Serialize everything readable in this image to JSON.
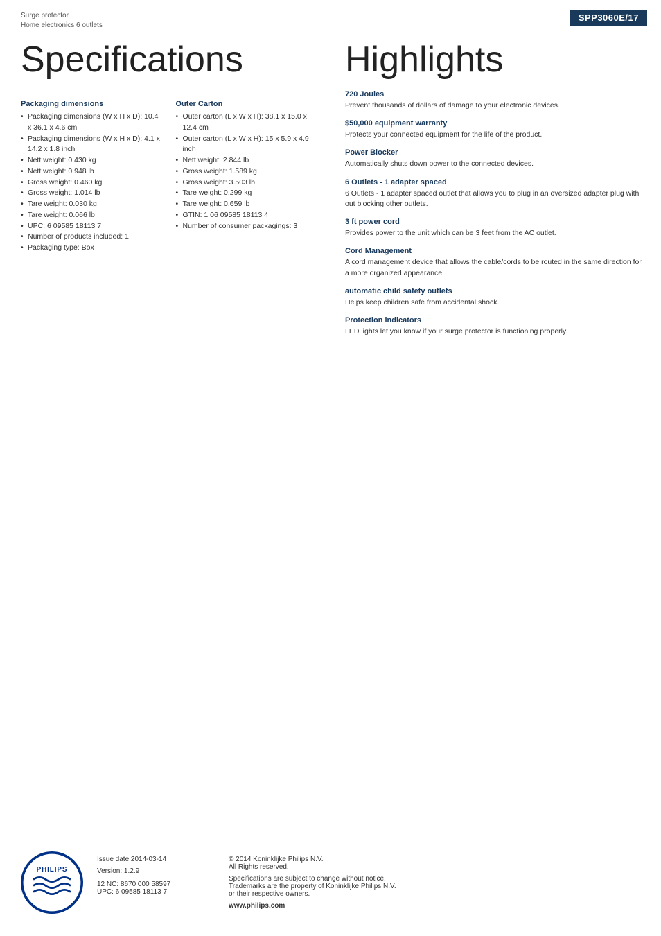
{
  "header": {
    "model": "SPP3060E/17",
    "product_type": "Surge protector",
    "product_name": "Home electronics 6 outlets"
  },
  "page_title": "Specifications",
  "highlights_title": "Highlights",
  "packaging": {
    "title": "Packaging dimensions",
    "items": [
      "Packaging dimensions (W x H x D): 10.4 x 36.1 x 4.6 cm",
      "Packaging dimensions (W x H x D): 4.1 x 14.2 x 1.8 inch",
      "Nett weight: 0.430 kg",
      "Nett weight: 0.948 lb",
      "Gross weight: 0.460 kg",
      "Gross weight: 1.014 lb",
      "Tare weight: 0.030 kg",
      "Tare weight: 0.066 lb",
      "UPC: 6 09585 18113 7",
      "Number of products included: 1",
      "Packaging type: Box"
    ]
  },
  "outer_carton": {
    "title": "Outer Carton",
    "items": [
      "Outer carton (L x W x H): 38.1 x 15.0 x 12.4 cm",
      "Outer carton (L x W x H): 15 x 5.9 x 4.9 inch",
      "Nett weight: 2.844 lb",
      "Gross weight: 1.589 kg",
      "Gross weight: 3.503 lb",
      "Tare weight: 0.299 kg",
      "Tare weight: 0.659 lb",
      "GTIN: 1 06 09585 18113 4",
      "Number of consumer packagings: 3"
    ]
  },
  "highlights": [
    {
      "title": "720 Joules",
      "desc": "Prevent thousands of dollars of damage to your electronic devices."
    },
    {
      "title": "$50,000 equipment warranty",
      "desc": "Protects your connected equipment for the life of the product."
    },
    {
      "title": "Power Blocker",
      "desc": "Automatically shuts down power to the connected devices."
    },
    {
      "title": "6 Outlets - 1 adapter spaced",
      "desc": "6 Outlets - 1 adapter spaced outlet that allows you to plug in an oversized adapter plug with out blocking other outlets."
    },
    {
      "title": "3 ft power cord",
      "desc": "Provides power to the unit which can be 3 feet from the AC outlet."
    },
    {
      "title": "Cord Management",
      "desc": "A cord management device that allows the cable/cords to be routed in the same direction for a more organized appearance"
    },
    {
      "title": "automatic child safety outlets",
      "desc": "Helps keep children safe from accidental shock."
    },
    {
      "title": "Protection indicators",
      "desc": "LED lights let you know if your surge protector is functioning properly."
    }
  ],
  "footer": {
    "issue_date_label": "Issue date 2014-03-14",
    "version_label": "Version: 1.2.9",
    "nc_label": "12 NC: 8670 000 58597",
    "upc_label": "UPC: 6 09585 18113 7",
    "copyright": "© 2014 Koninklijke Philips N.V.\nAll Rights reserved.",
    "spec_notice": "Specifications are subject to change without notice.\nTrademarks are the property of Koninklijke Philips N.V.\nor their respective owners.",
    "website": "www.philips.com"
  }
}
